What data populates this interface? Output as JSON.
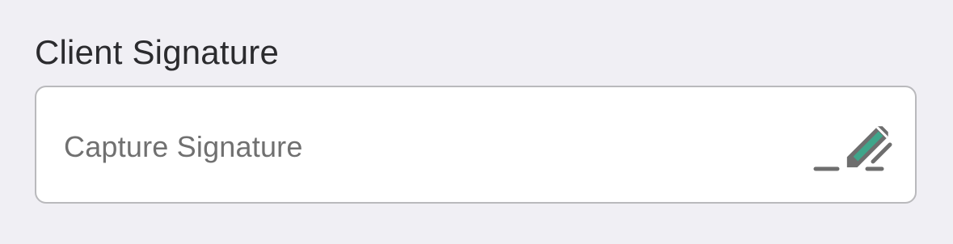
{
  "field": {
    "label": "Client Signature",
    "placeholder": "Capture Signature",
    "icon": "signature-pen-icon"
  },
  "colors": {
    "background": "#f0eff4",
    "field_background": "#ffffff",
    "field_border": "#b9b9bc",
    "label_text": "#2b2b2e",
    "placeholder_text": "#707070",
    "icon_gray": "#6e6e6e",
    "icon_accent": "#3fa58a"
  }
}
